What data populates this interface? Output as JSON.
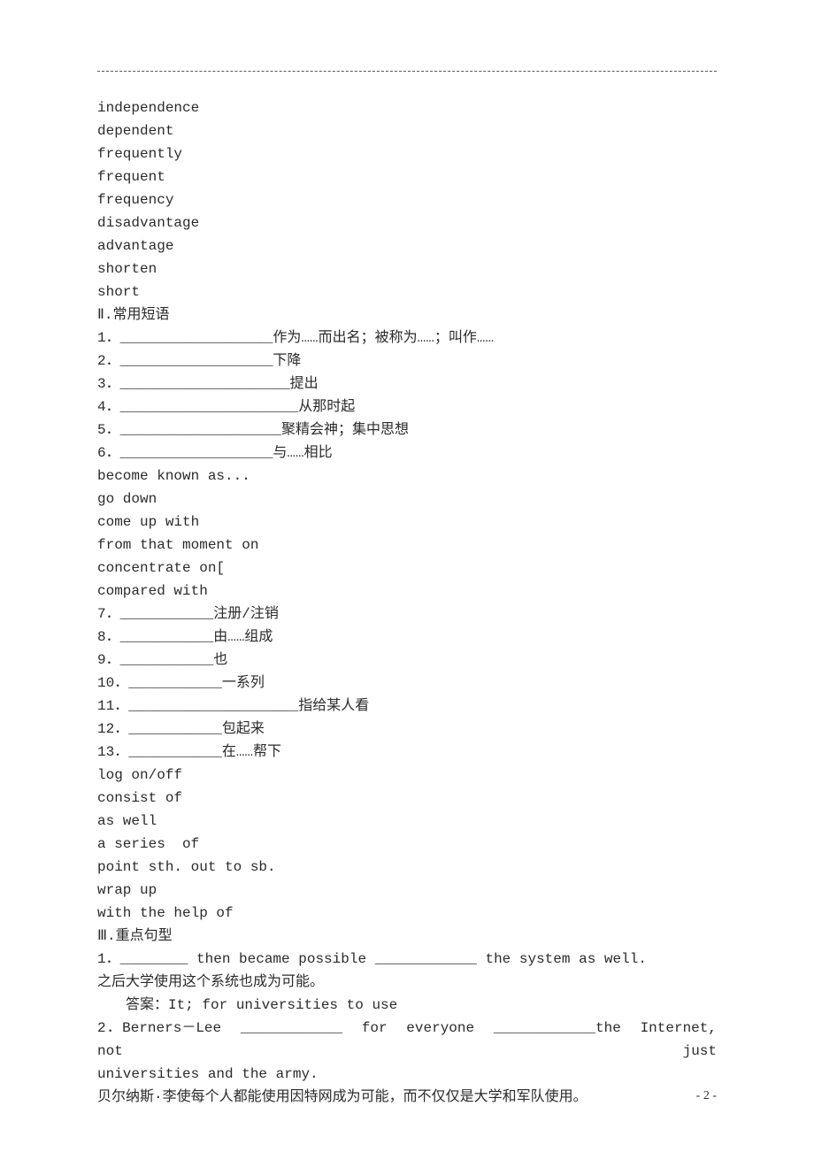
{
  "vocab": [
    "independence",
    "dependent",
    "frequently",
    "frequent",
    "frequency",
    "disadvantage",
    "advantage",
    "shorten",
    "short"
  ],
  "section2_title": "Ⅱ.常用短语",
  "phrases1": [
    "1．__________________作为……而出名；被称为……；叫作……",
    "2．__________________下降",
    "3．____________________提出",
    "4．_____________________从那时起",
    "5．___________________聚精会神；集中思想",
    "6．__________________与……相比"
  ],
  "answers1": [
    "become known as...",
    "go down",
    "come up with",
    "from that moment on",
    "concentrate on["
  ],
  "blank_line": "",
  "answers1b": [
    "compared with"
  ],
  "phrases2": [
    "7．___________注册/注销",
    "8．___________由……组成",
    "9．___________也",
    "10．___________一系列",
    "11．____________________指给某人看",
    "12．___________包起来",
    "13．___________在……帮下"
  ],
  "answers2": [
    "log on/off",
    "consist of",
    "as well",
    "a series  of",
    "point sth. out to sb.",
    "wrap up",
    "with the help of"
  ],
  "section3_title": "Ⅲ.重点句型",
  "q1": "1．________ then became possible ____________ the system as well.",
  "q1_cn": "之后大学使用这个系统也成为可能。",
  "q1_ans": "答案：It; for universities to use",
  "q2a": "2．Berners－Lee  ____________  for  everyone  ____________the  Internet,  not  just",
  "q2b": "universities and the army.",
  "q2_cn": "贝尔纳斯·李使每个人都能使用因特网成为可能，而不仅仅是大学和军队使用。",
  "footer": "- 2 -"
}
